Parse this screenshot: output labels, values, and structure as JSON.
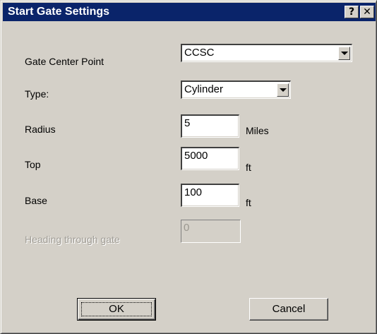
{
  "dialog": {
    "title": "Start Gate Settings",
    "help_glyph": "?",
    "close_glyph": "✕"
  },
  "fields": {
    "gate_center_point": {
      "label": "Gate Center Point",
      "value": "CCSC"
    },
    "type": {
      "label": "Type:",
      "value": "Cylinder"
    },
    "radius": {
      "label": "Radius",
      "value": "5",
      "unit": "Miles"
    },
    "top": {
      "label": "Top",
      "value": "5000",
      "unit": "ft"
    },
    "base": {
      "label": "Base",
      "value": "100",
      "unit": "ft"
    },
    "heading": {
      "label": "Heading through gate",
      "value": "0",
      "enabled": false
    }
  },
  "buttons": {
    "ok": "OK",
    "cancel": "Cancel"
  },
  "colors": {
    "title_bar": "#0a246a",
    "face": "#d4d0c8"
  }
}
